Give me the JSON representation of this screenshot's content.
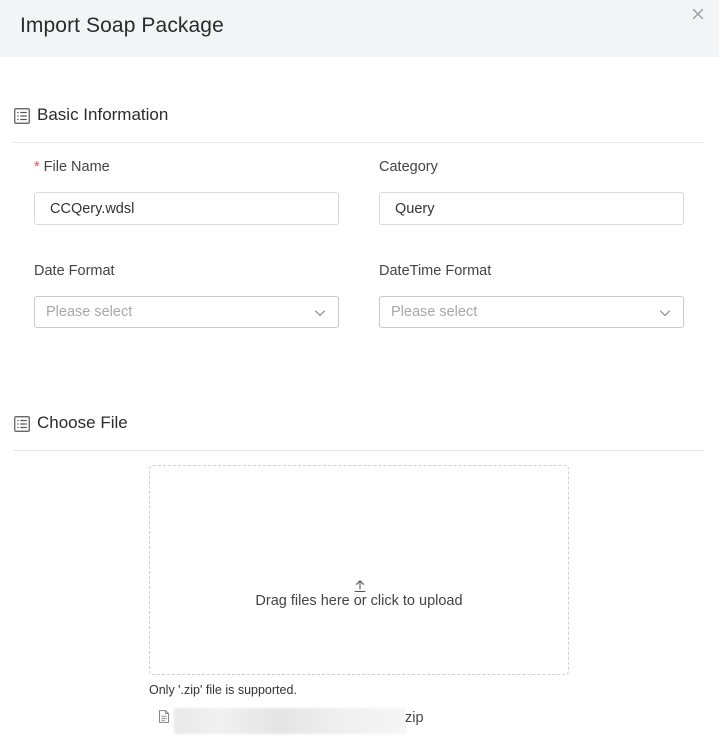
{
  "dialog": {
    "title": "Import Soap Package",
    "close_icon": "close-icon"
  },
  "basic_info": {
    "section_title": "Basic Information",
    "section_icon": "list-icon",
    "file_name": {
      "required_mark": "*",
      "label": "File Name",
      "value": "CCQery.wdsl"
    },
    "category": {
      "label": "Category",
      "value": "Query"
    },
    "date_format": {
      "label": "Date Format",
      "placeholder": "Please select",
      "chevron_icon": "chevron-down-icon"
    },
    "datetime_format": {
      "label": "DateTime Format",
      "placeholder": "Please select",
      "chevron_icon": "chevron-down-icon"
    }
  },
  "choose_file": {
    "section_title": "Choose File",
    "section_icon": "list-icon",
    "upload_icon": "upload-icon",
    "upload_text": "Drag files here or click to upload",
    "hint": "Only '.zip' file is supported.",
    "file": {
      "icon": "file-icon",
      "extension": "zip"
    }
  },
  "colors": {
    "header_bg": "#f3f4f6",
    "required": "#e34d59",
    "border": "#d9d9d9",
    "placeholder": "#a8a8a8"
  }
}
